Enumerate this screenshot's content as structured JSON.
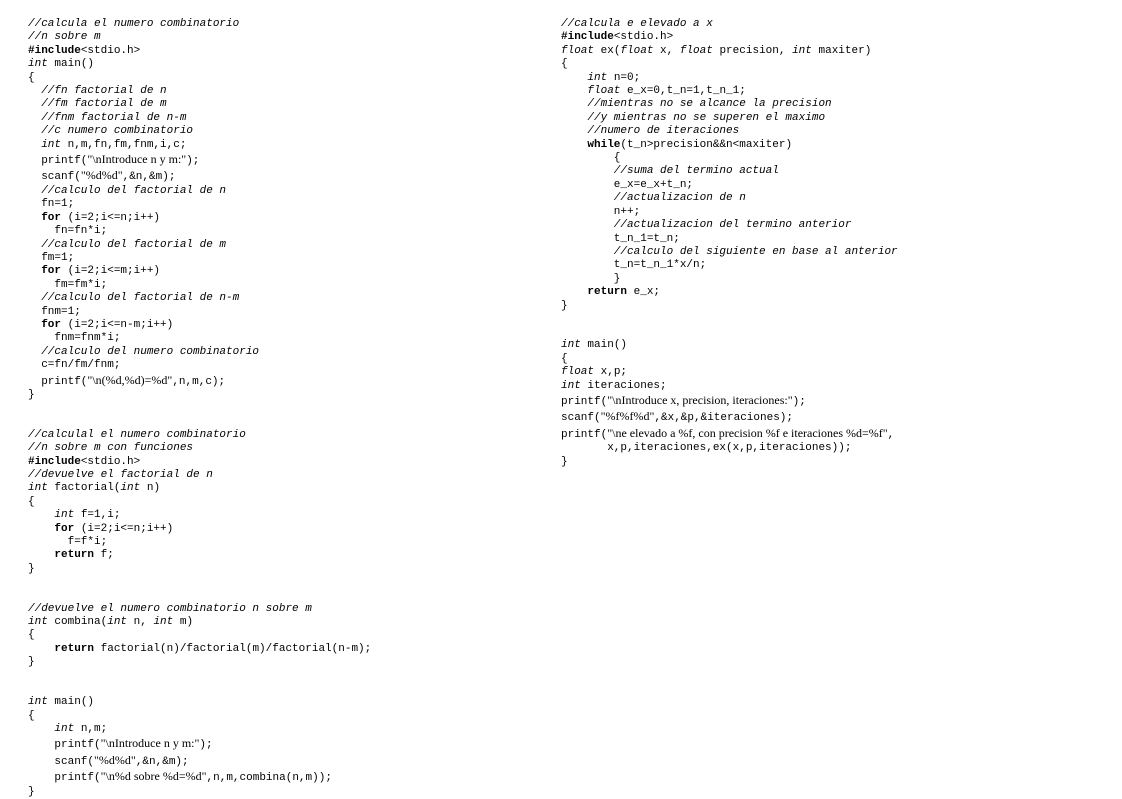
{
  "col1": {
    "l1": "//calcula el numero combinatorio",
    "l2": "//n sobre m",
    "inc": "#include",
    "inc_h": "<stdio.h>",
    "kint": "int",
    "main_sig": " main()",
    "ob": "{",
    "cb": "}",
    "c1": "  //fn factorial de n",
    "c2": "  //fm factorial de m",
    "c3": "  //fnm factorial de n-m",
    "c4": "  //c numero combinatorio",
    "decl": "  int",
    "decl_vars": " n,m,fn,fm,fnm,i,c;",
    "p1a": "  printf(",
    "p1s": "\"\\nIntroduce n y m:\"",
    "p1b": ");",
    "sc1a": "  scanf(",
    "sc1s": "\"%d%d\"",
    "sc1b": ",&n,&m);",
    "cc1": "  //calculo del factorial de n",
    "fn1": "  fn=1;",
    "kfor": "  for",
    "for1": " (i=2;i<=n;i++)",
    "fn2": "    fn=fn*i;",
    "cc2": "  //calculo del factorial de m",
    "fm1": "  fm=1;",
    "for2": " (i=2;i<=m;i++)",
    "fm2": "    fm=fm*i;",
    "cc3": "  //calculo del factorial de n-m",
    "fnm1": "  fnm=1;",
    "for3": " (i=2;i<=n-m;i++)",
    "fnm2": "    fnm=fnm*i;",
    "cc4": "  //calculo del numero combinatorio",
    "cexp": "  c=fn/fm/fnm;",
    "p2a": "  printf(",
    "p2s": "\"\\n(%d,%d)=%d\"",
    "p2b": ",n,m,c);",
    "b2l1": "//calculal el numero combinatorio",
    "b2l2": "//n sobre m con funciones",
    "b2c1": "//devuelve el factorial de n",
    "fact_sig": " factorial(",
    "fact_sig2": " n)",
    "fact_d1": "    int",
    "fact_d1b": " f=1,i;",
    "fact_kfor": "    for",
    "fact_for": " (i=2;i<=n;i++)",
    "fact_body": "      f=f*i;",
    "kret": "    return",
    "fact_ret": " f;",
    "comb_c": "//devuelve el numero combinatorio n sobre m",
    "comb_sig1": " combina(",
    "comb_sig2": " n, ",
    "comb_sig3": " m)",
    "comb_ret": " factorial(n)/factorial(m)/factorial(n-m);",
    "m2_d": "    int",
    "m2_dv": " n,m;",
    "m2_p1a": "    printf(",
    "m2_p1s": "\"\\nIntroduce n y m:\"",
    "m2_p1b": ");",
    "m2_sc1a": "    scanf(",
    "m2_sc1s": "\"%d%d\"",
    "m2_sc1b": ",&n,&m);",
    "m2_p2a": "    printf(",
    "m2_p2s": "\"\\n%d sobre %d=%d\"",
    "m2_p2b": ",n,m,combina(n,m));"
  },
  "col2": {
    "l1": "//calcula e elevado a x",
    "inc": "#include",
    "inc_h": "<stdio.h>",
    "kfloat": "float",
    "ex_sig1": " ex(",
    "ex_sig2": " x, ",
    "ex_sig3": " precision, ",
    "kint": "int",
    "ex_sig4": " maxiter)",
    "ob": "{",
    "cb": "}",
    "d1a": "    int",
    "d1b": " n=0;",
    "d2a": "    float",
    "d2b": " e_x=0,t_n=1,t_n_1;",
    "c1": "    //mientras no se alcance la precision",
    "c2": "    //y mientras no se superen el maximo",
    "c3": "    //numero de iteraciones",
    "kwhile": "    while",
    "whcond": "(t_n>precision&&n<maxiter)",
    "wob": "        {",
    "wc1": "        //suma del termino actual",
    "we1": "        e_x=e_x+t_n;",
    "wc2": "        //actualizacion de n",
    "we2": "        n++;",
    "wc3": "        //actualizacion del termino anterior",
    "we3": "        t_n_1=t_n;",
    "wc4": "        //calculo del siguiente en base al anterior",
    "we4": "        t_n=t_n_1*x/n;",
    "wcb": "        }",
    "kret": "    return",
    "retv": " e_x;",
    "main_sig": " main()",
    "md1": "float",
    "md1b": " x,p;",
    "md2": "int",
    "md2b": " iteraciones;",
    "mp1a": "printf(",
    "mp1s": "\"\\nIntroduce x, precision, iteraciones:\"",
    "mp1b": ");",
    "msc1a": "scanf(",
    "msc1s": "\"%f%f%d\"",
    "msc1b": ",&x,&p,&iteraciones);",
    "mp2a": "printf(",
    "mp2s": "\"\\ne elevado a %f, con precision %f e iteraciones %d=%f\"",
    "mp2b": ",",
    "mp2c": "       x,p,iteraciones,ex(x,p,iteraciones));"
  }
}
